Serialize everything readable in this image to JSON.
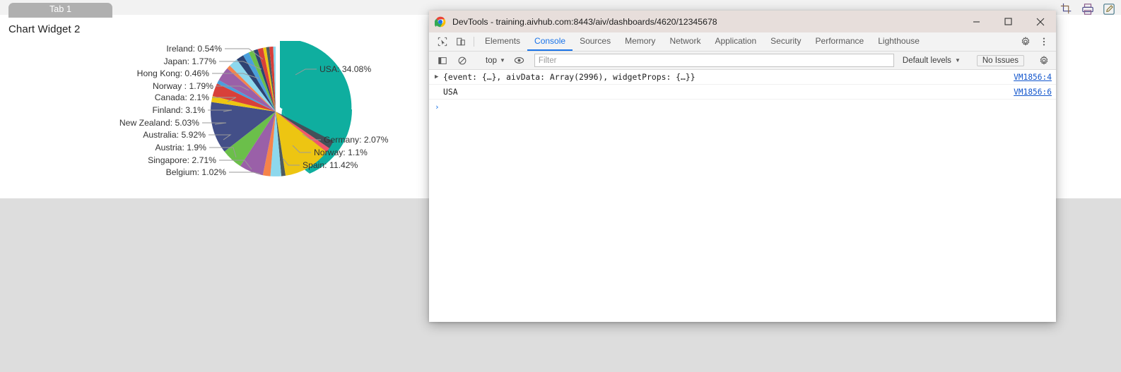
{
  "dashboard": {
    "tab_label": "Tab 1",
    "widget_title": "Chart Widget 2",
    "toolbar_icons": [
      "crop-icon",
      "print-icon",
      "edit-icon"
    ]
  },
  "devtools": {
    "title": "DevTools - training.aivhub.com:8443/aiv/dashboards/4620/12345678",
    "window_buttons": [
      "minimize",
      "maximize",
      "close"
    ],
    "tabs": [
      {
        "label": "Elements",
        "active": false
      },
      {
        "label": "Console",
        "active": true
      },
      {
        "label": "Sources",
        "active": false
      },
      {
        "label": "Memory",
        "active": false
      },
      {
        "label": "Network",
        "active": false
      },
      {
        "label": "Application",
        "active": false
      },
      {
        "label": "Security",
        "active": false
      },
      {
        "label": "Performance",
        "active": false
      },
      {
        "label": "Lighthouse",
        "active": false
      }
    ],
    "console_toolbar": {
      "context": "top",
      "filter_placeholder": "Filter",
      "filter_value": "",
      "levels_label": "Default levels",
      "issues_label": "No Issues"
    },
    "console_logs": [
      {
        "expandable": true,
        "message": "{event: {…}, aivData: Array(2996), widgetProps: {…}}",
        "source": "VM1856:4"
      },
      {
        "expandable": false,
        "message": "USA",
        "source": "VM1856:6"
      }
    ],
    "prompt": "›"
  },
  "chart_data": {
    "type": "pie",
    "title": "Chart Widget 2",
    "labels": [
      "USA",
      "Germany",
      "Norway",
      "Spain",
      "Belgium",
      "Singapore",
      "Austria",
      "Australia",
      "New Zealand",
      "Finland",
      "Canada",
      "Norway ",
      "Hong Kong",
      "Japan",
      "Ireland"
    ],
    "values": [
      34.08,
      2.07,
      1.1,
      11.42,
      1.02,
      2.71,
      1.9,
      5.92,
      5.03,
      3.1,
      2.1,
      1.79,
      0.46,
      1.77,
      0.54
    ],
    "unit": "%",
    "colors": [
      "#0fae9f",
      "#42515a",
      "#f0566b",
      "#edc512",
      "#4f5b5f",
      "#8dd8ed",
      "#f5834a",
      "#9a60a8",
      "#6bbf4a",
      "#434f88",
      "#edc512",
      "#d8403a",
      "#4a9fdc",
      "#2e4272",
      "#8dd8ed"
    ],
    "exploded_slice": "USA",
    "labels_formatted": [
      "USA: 34.08%",
      "Germany: 2.07%",
      "Norway: 1.1%",
      "Spain: 11.42%",
      "Belgium: 1.02%",
      "Singapore: 2.71%",
      "Austria: 1.9%",
      "Australia: 5.92%",
      "New Zealand: 5.03%",
      "Finland: 3.1%",
      "Canada: 2.1%",
      "Norway : 1.79%",
      "Hong Kong: 0.46%",
      "Japan: 1.77%",
      "Ireland: 0.54%"
    ],
    "legend": "none",
    "data_labels": true
  }
}
